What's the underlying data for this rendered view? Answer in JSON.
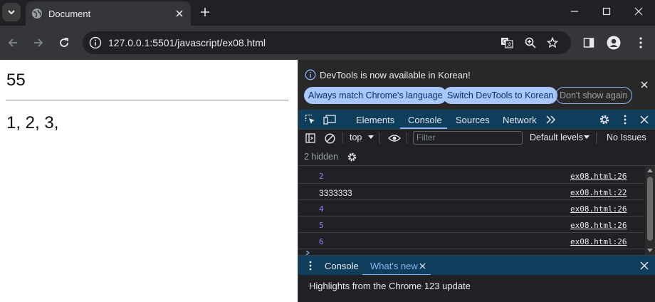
{
  "browser": {
    "tab_title": "Document",
    "url": "127.0.0.1:5501/javascript/ex08.html"
  },
  "page": {
    "heading": "55",
    "line2": "1, 2, 3,"
  },
  "devtools": {
    "infobar": {
      "message": "DevTools is now available in Korean!",
      "btn_match": "Always match Chrome's language",
      "btn_switch": "Switch DevTools to Korean",
      "btn_dismiss": "Don't show again"
    },
    "tabs": [
      "Elements",
      "Console",
      "Sources",
      "Network"
    ],
    "active_tab": "Console",
    "console_toolbar": {
      "context": "top",
      "filter_placeholder": "Filter",
      "levels": "Default levels",
      "issues": "No Issues"
    },
    "hidden_label": "2 hidden",
    "logs": [
      {
        "value": "2",
        "type": "num",
        "source": "ex08.html:26"
      },
      {
        "value": "3333333",
        "type": "str",
        "source": "ex08.html:22"
      },
      {
        "value": "4",
        "type": "num",
        "source": "ex08.html:26"
      },
      {
        "value": "5",
        "type": "num",
        "source": "ex08.html:26"
      },
      {
        "value": "6",
        "type": "num",
        "source": "ex08.html:26"
      }
    ],
    "drawer": {
      "tab_console": "Console",
      "tab_whats_new": "What's new",
      "highlight": "Highlights from the Chrome 123 update"
    }
  },
  "colors": {
    "accent": "#8ab4f8",
    "pill_fill": "#a8c7fa",
    "number_log": "#9980ff",
    "devtools_tabbar": "#0f3d5c"
  }
}
